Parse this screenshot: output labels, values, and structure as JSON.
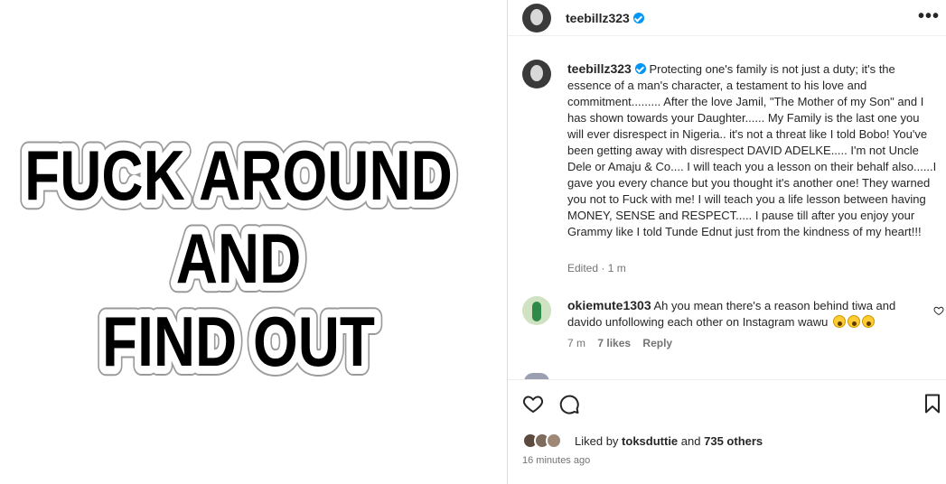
{
  "media": {
    "lines": [
      "FUCK AROUND",
      "AND",
      "FIND OUT"
    ]
  },
  "header": {
    "username": "teebillz323",
    "more_icon": "more-horizontal-icon"
  },
  "caption": {
    "username": "teebillz323",
    "text": "Protecting one's family is not just a duty; it's the essence of a man's character, a testament to his love and commitment......... After the love Jamil, \"The Mother of my Son\" and I has shown towards your Daughter...... My Family is the last one you will ever disrespect in Nigeria.. it's not a threat like I told Bobo! You've been getting away with disrespect DAVID ADELKE..... I'm not Uncle Dele or Amaju & Co.... I will teach you a lesson on their behalf also......I gave you every chance but you thought it's another one! They warned you not to Fuck with me! I will teach you a life lesson between having MONEY, SENSE and RESPECT..... I pause till after you enjoy your Grammy like I told Tunde Ednut just from the kindness of my heart!!!",
    "edited": "Edited · 1 m"
  },
  "comment": {
    "username": "okiemute1303",
    "text": "Ah you mean there's a reason behind tiwa and davido unfollowing each other on Instagram wawu",
    "emoji_count": 3,
    "time": "7 m",
    "likes": "7 likes",
    "reply": "Reply"
  },
  "actions": {
    "liked_by_prefix": "Liked by",
    "liked_by_user": "toksduttie",
    "and": "and",
    "others": "735 others",
    "timestamp": "16 minutes ago"
  },
  "colors": {
    "verified": "#0095f6",
    "muted": "#737373",
    "text": "#262626"
  }
}
